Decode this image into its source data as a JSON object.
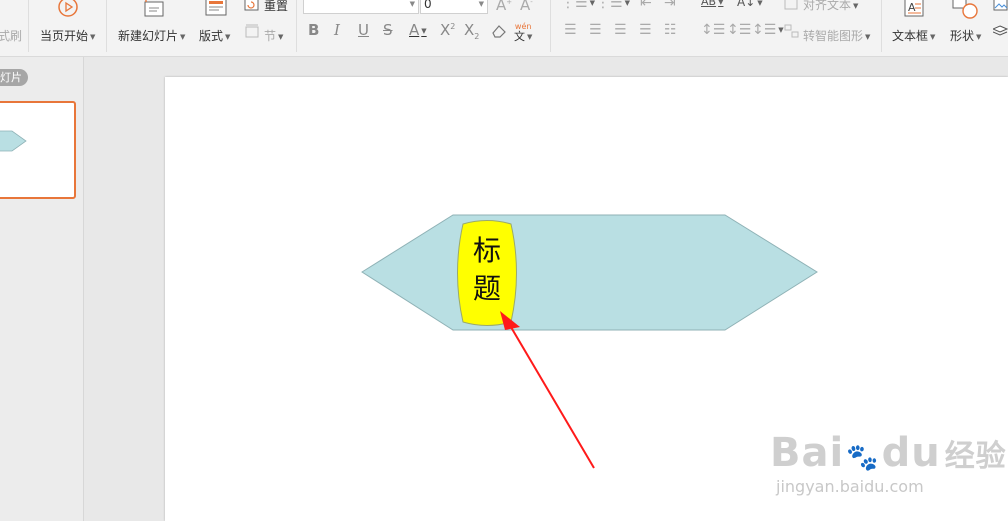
{
  "toolbar": {
    "format_painter_partial": "式刷",
    "from_current": "当页开始",
    "new_slide": "新建幻灯片",
    "layout": "版式",
    "reset": "重置",
    "section": "节",
    "font_name_value": "",
    "font_size_value": "0",
    "align_text": "对齐文本",
    "smartart": "转智能图形",
    "textbox": "文本框",
    "shape": "形状"
  },
  "left_panel": {
    "tab_partial": "灯片"
  },
  "slide": {
    "title_line1": "标",
    "title_line2": "题",
    "colors": {
      "hexagon_fill": "#b9dfe3",
      "hexagon_stroke": "#8fb2b6",
      "callout_fill": "#ffff00",
      "callout_stroke": "#9aaa6a",
      "arrow": "#ff1a1a"
    }
  },
  "watermark": {
    "brand": "Bai",
    "brand2": "du",
    "cn": "经验",
    "url": "jingyan.baidu.com"
  },
  "ui_colors": {
    "selection": "#e8763a"
  }
}
